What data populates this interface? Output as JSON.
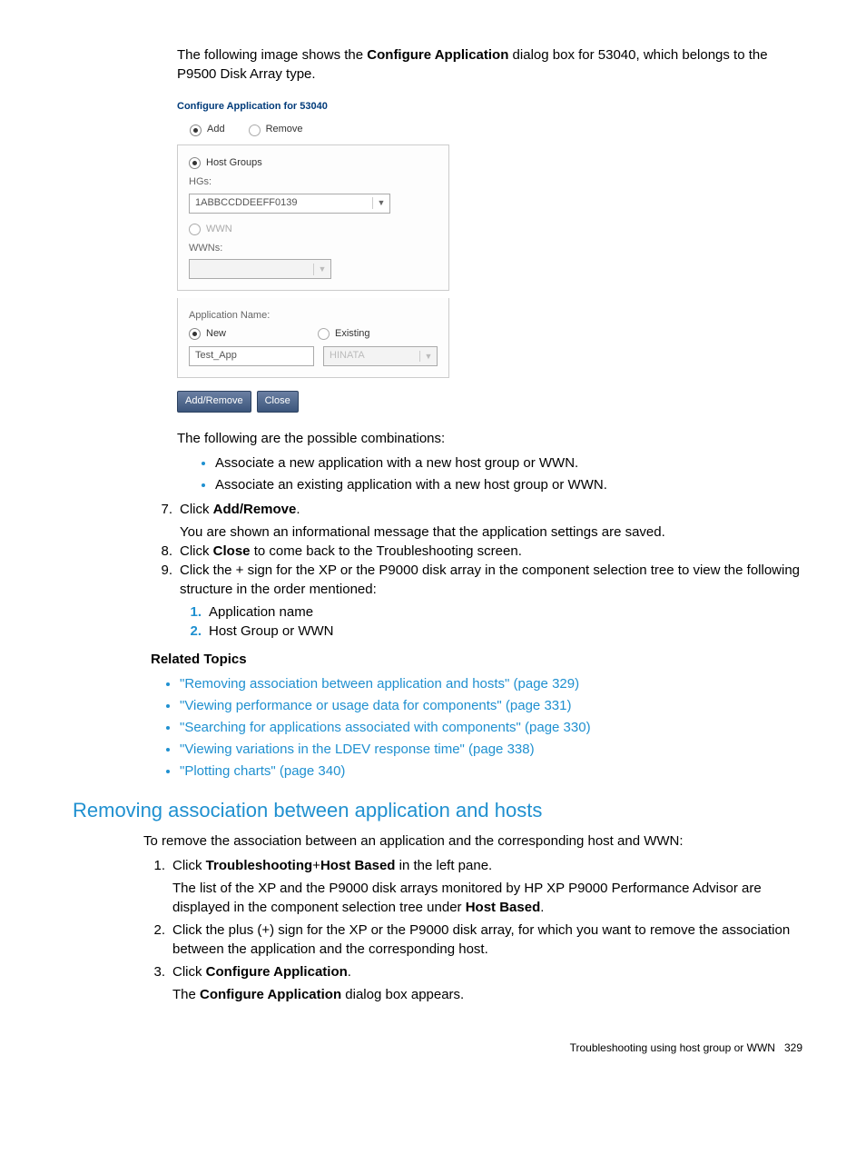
{
  "intro": {
    "p1a": "The following image shows the ",
    "p1b": "Configure Application",
    "p1c": " dialog box for 53040, which belongs to the P9500 Disk Array type."
  },
  "dialog": {
    "title": "Configure Application for 53040",
    "add": "Add",
    "remove": "Remove",
    "hostGroups": "Host Groups",
    "hgsLabel": "HGs:",
    "hgsValue": "1ABBCCDDEEFF0139",
    "wwn": "WWN",
    "wwnsLabel": "WWNs:",
    "appNameLabel": "Application Name:",
    "new": "New",
    "existing": "Existing",
    "newValue": "Test_App",
    "existingValue": "HINATA",
    "addRemoveBtn": "Add/Remove",
    "closeBtn": "Close"
  },
  "possible": "The following are the possible combinations:",
  "combinations": [
    "Associate a new application with a new host group or WWN.",
    "Associate an existing application with a new host group or WWN."
  ],
  "steps": {
    "s7a": "Click ",
    "s7b": "Add/Remove",
    "s7c": ".",
    "s7body": "You are shown an informational message that the application settings are saved.",
    "s8a": "Click ",
    "s8b": "Close",
    "s8c": " to come back to the Troubleshooting screen.",
    "s9": "Click the + sign for the XP or the P9000 disk array in the component selection tree to view the following structure in the order mentioned:",
    "s9_1": "Application name",
    "s9_2": "Host Group or WWN"
  },
  "relatedTitle": "Related Topics",
  "related": [
    "\"Removing association between application and hosts\" (page 329)",
    "\"Viewing performance or usage data for components\" (page 331)",
    "\"Searching for applications associated with components\" (page 330)",
    "\"Viewing variations in the LDEV response time\" (page 338)",
    "\"Plotting charts\" (page 340)"
  ],
  "section2": {
    "heading": "Removing association between application and hosts",
    "intro": "To remove the association between an application and the corresponding host and WWN:",
    "s1a": "Click ",
    "s1b": "Troubleshooting",
    "s1c": "+",
    "s1d": "Host Based",
    "s1e": " in the left pane.",
    "s1body_a": "The list of the XP and the P9000 disk arrays monitored by HP XP P9000 Performance Advisor are displayed in the component selection tree under ",
    "s1body_b": "Host Based",
    "s1body_c": ".",
    "s2": "Click the plus (+) sign for the XP or the P9000 disk array, for which you want to remove the association between the application and the corresponding host.",
    "s3a": "Click ",
    "s3b": "Configure Application",
    "s3c": ".",
    "s3body_a": "The ",
    "s3body_b": "Configure Application",
    "s3body_c": " dialog box appears."
  },
  "footer": {
    "text": "Troubleshooting using host group or WWN",
    "page": "329"
  }
}
